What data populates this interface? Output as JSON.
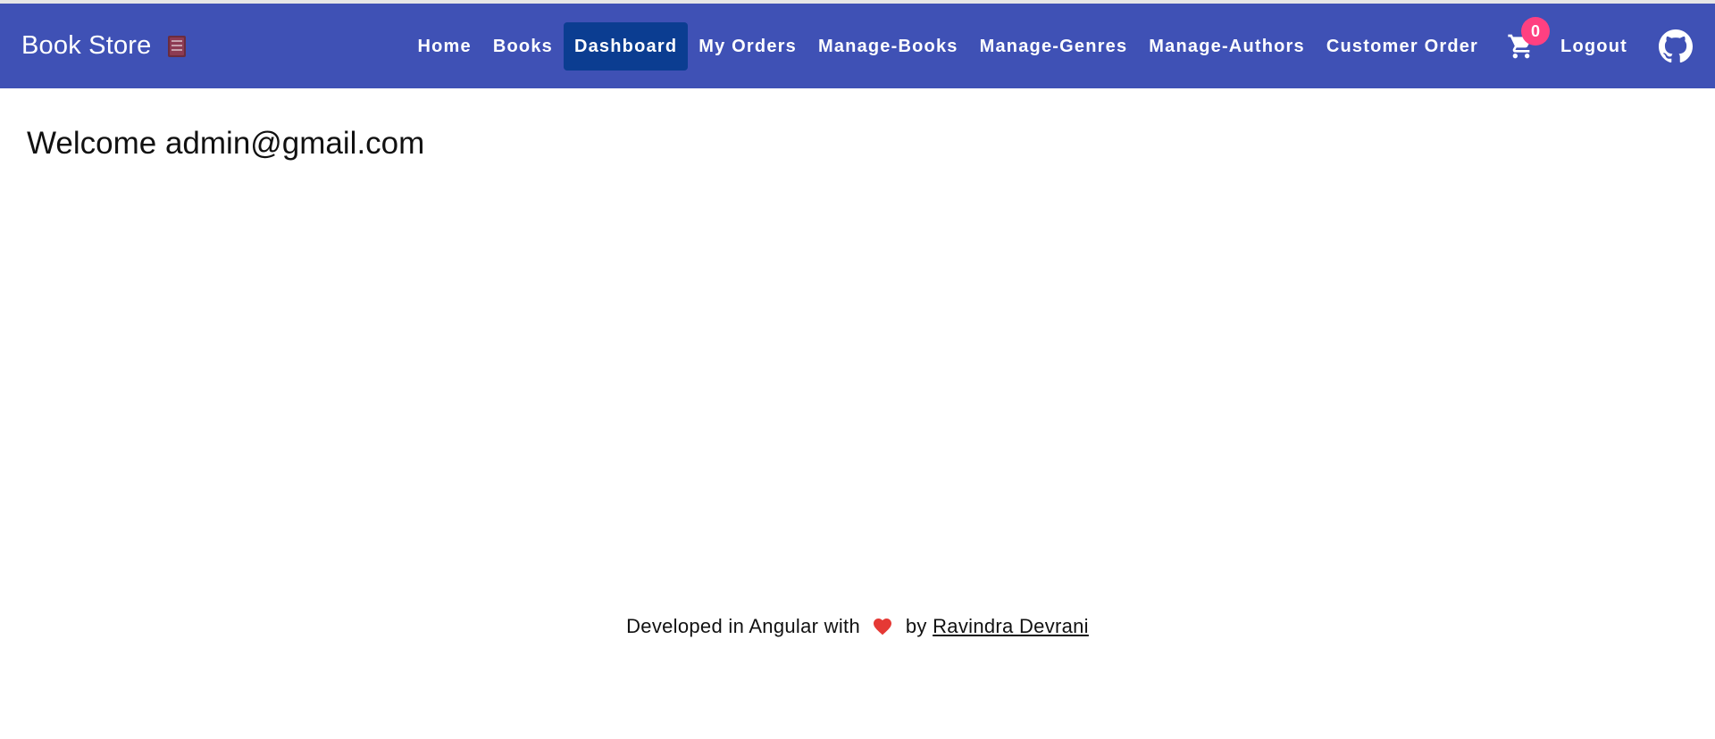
{
  "app": {
    "brand": "Book Store"
  },
  "nav": {
    "items": [
      {
        "label": "Home"
      },
      {
        "label": "Books"
      },
      {
        "label": "Dashboard"
      },
      {
        "label": "My Orders"
      },
      {
        "label": "Manage-Books"
      },
      {
        "label": "Manage-Genres"
      },
      {
        "label": "Manage-Authors"
      },
      {
        "label": "Customer Order"
      }
    ],
    "active": "Dashboard",
    "cart_count": "0",
    "logout_label": "Logout"
  },
  "main": {
    "welcome": "Welcome admin@gmail.com"
  },
  "footer": {
    "prefix": "Developed in Angular with",
    "by": "by",
    "author": "Ravindra Devrani"
  },
  "colors": {
    "navbar": "#3f51b5",
    "active_link": "#0b3d91",
    "badge": "#ff4081",
    "heart": "#e53935"
  },
  "icons": {
    "brand": "books-icon",
    "cart": "cart-icon",
    "github": "github-icon",
    "footer": "heart-icon"
  }
}
